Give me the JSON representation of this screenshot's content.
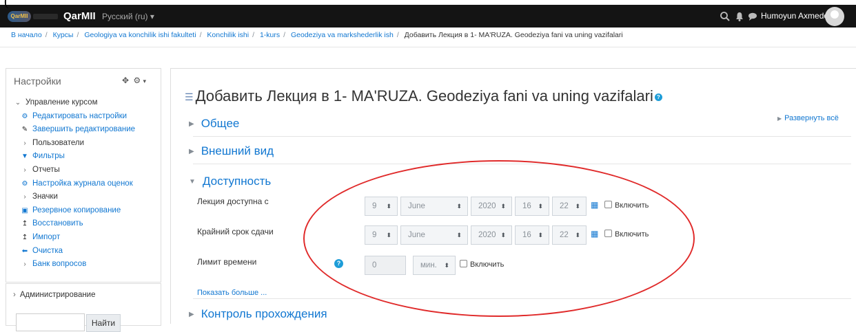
{
  "navbar": {
    "brand": "QarMII",
    "language": "Русский (ru) ▾",
    "user_name": "Humoyun Axmedov"
  },
  "breadcrumb": {
    "items": [
      "В начало",
      "Курсы",
      "Geologiya va konchilik ishi fakulteti",
      "Konchilik ishi",
      "1-kurs",
      "Geodeziya va markshederlik ish"
    ],
    "current": "Добавить Лекция в 1- MA'RUZA. Geodeziya fani va uning vazifalari"
  },
  "settings": {
    "title": "Настройки",
    "course_admin": "Управление курсом",
    "items": [
      {
        "label": "Редактировать настройки",
        "icon": "gear-icon"
      },
      {
        "label": "Завершить редактирование",
        "icon": "pencil-icon"
      },
      {
        "label": "Пользователи",
        "icon": "chevron-right-icon"
      },
      {
        "label": "Фильтры",
        "icon": "filter-icon"
      },
      {
        "label": "Отчеты",
        "icon": "chevron-right-icon"
      },
      {
        "label": "Настройка журнала оценок",
        "icon": "gear-icon"
      },
      {
        "label": "Значки",
        "icon": "chevron-right-icon"
      },
      {
        "label": "Резервное копирование",
        "icon": "backup-icon"
      },
      {
        "label": "Восстановить",
        "icon": "upload-icon"
      },
      {
        "label": "Импорт",
        "icon": "upload-icon"
      },
      {
        "label": "Очистка",
        "icon": "arrow-left-icon"
      },
      {
        "label": "Банк вопросов",
        "icon": "chevron-right-icon"
      }
    ],
    "administration": "Администрирование",
    "search_button": "Найти"
  },
  "main": {
    "title": "Добавить Лекция в 1- MA'RUZA. Geodeziya fani va uning vazifalari",
    "expand_all": "Развернуть всё",
    "sections": {
      "general": "Общее",
      "appearance": "Внешний вид",
      "availability": "Доступность",
      "completion": "Контроль прохождения"
    },
    "available_from": {
      "label": "Лекция доступна с",
      "day": "9",
      "month": "June",
      "year": "2020",
      "hour": "16",
      "minute": "22",
      "enable": "Включить"
    },
    "deadline": {
      "label": "Крайний срок сдачи",
      "day": "9",
      "month": "June",
      "year": "2020",
      "hour": "16",
      "minute": "22",
      "enable": "Включить"
    },
    "time_limit": {
      "label": "Лимит времени",
      "value": "0",
      "unit": "мин.",
      "enable": "Включить"
    },
    "show_more": "Показать больше ..."
  }
}
